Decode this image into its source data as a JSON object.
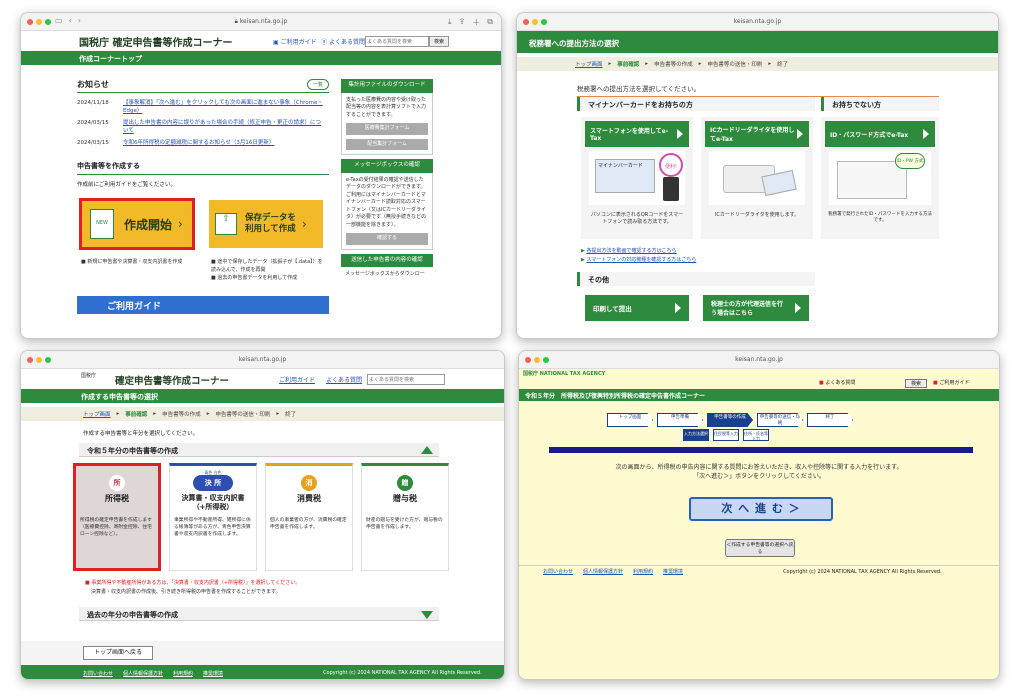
{
  "w1": {
    "url": "keisan.nta.go.jp",
    "logo": "国税庁 確定申告書等作成コーナー",
    "guide": "ご利用ガイド",
    "faq": "よくある質問",
    "search_placeholder": "よくある質問を検索",
    "search_btn": "検索",
    "bar": "作成コーナートップ",
    "notice_title": "お知らせ",
    "notice_btn": "一覧",
    "notices": [
      {
        "date": "2024/11/18",
        "text": "【事象解消】「次へ進む」をクリックしても次の画面に進まない事象（Chrome・Edge）"
      },
      {
        "date": "2024/03/15",
        "text": "提出した申告書の内容に誤りがあった場合の手続（修正申告・更正の請求）について"
      },
      {
        "date": "2024/03/15",
        "text": "令和6年所得税の定額減税に関するお知らせ（3月16日更新）"
      }
    ],
    "create_title": "申告書等を作成する",
    "create_sub": "作成前にご利用ガイドをご覧ください。",
    "start_new": "NEW",
    "start_label": "作成開始",
    "resume_label_1": "保存データを",
    "resume_label_2": "利用して作成",
    "start_note": "新規に申告書や決算書・収支内訳書を作成",
    "resume_notes": [
      "途中で保存したデータ（拡張子が【.data】）を読み込んで、作成を再開",
      "過去の申告書データを利用して作成"
    ],
    "banner": "ご利用ガイド",
    "side_dl_head": "集計用ファイルのダウンロード",
    "side_dl_text": "支払った医療費の内容や受け取った配当等の内容を表計算ソフトで入力することができます。",
    "side_dl_btn1": "医療費集計フォーム",
    "side_dl_btn2": "配当集計フォーム",
    "side_msg_head": "メッセージボックスの確認",
    "side_msg_text": "e-Taxの受付結果の確認や送信したデータのダウンロードができます。ご利用にはマイナンバーカードとマイナンバーカード読取対応のスマートフォン（又はICカードリーダライタ）が必要です（無授手続きなどの一部機能を除きます）。",
    "side_msg_btn": "確認する",
    "side_send_head": "送信した申告書の内容の確認",
    "side_send_text": "メッセージボックスからダウンロー"
  },
  "w2": {
    "url": "keisan.nta.go.jp",
    "bar": "税務署への提出方法の選択",
    "crumbs": [
      "トップ画面",
      "事前確認",
      "申告書等の作成",
      "申告書等の送信・印刷",
      "終了"
    ],
    "lead": "税務署への提出方法を選択してください。",
    "myna_head": "マイナンバーカードをお持ちの方",
    "nomyna_head": "お持ちでない方",
    "opt1": "スマートフォンを使用してe-Tax",
    "opt2": "ICカードリーダライタを使用してe-Tax",
    "opt3": "ID・パスワード方式でe-Tax",
    "card_label": "マイナンバーカード",
    "cap1": "パソコンに表示されるQRコードをスマートフォンで読み取る方法です。",
    "cap2": "ICカードリーダライタを使用します。",
    "cap3": "税務署で発行されたID・パスワードを入力する方法です。",
    "idpw_badge": "ID・PW 方式",
    "link1": "各提出方法を動画で確認する方はこちら",
    "link2": "スマートフォンの対応機種を確認する方はこちら",
    "other_head": "その他",
    "other1": "印刷して提出",
    "other2": "税理士の方が代理送信を行う場合はこちら"
  },
  "w3": {
    "url": "keisan.nta.go.jp",
    "agency": "国税庁",
    "logo": "確定申告書等作成コーナー",
    "guide": "ご利用ガイド",
    "faq": "よくある質問",
    "search_placeholder": "よくある質問を検索",
    "bar": "作成する申告書等の選択",
    "crumbs": [
      "トップ画面",
      "事前確認",
      "申告書等の作成",
      "申告書等の送信・印刷",
      "終了"
    ],
    "lead": "作成する申告書等と年分を選択してください。",
    "section1": "令和５年分の申告書等の作成",
    "cards": [
      {
        "badge": "所",
        "title": "所得税",
        "desc": "所得税の確定申告書を作成します（医療費控除、寄附金控除、住宅ローン控除など）。",
        "color": "#c03a3a"
      },
      {
        "badge": "決 所",
        "title": "決算書・収支内訳書\n（+所得税）",
        "desc": "事業所得や不動産所得、雑所得に係る帳簿等がある方が、青色申告決算書や収支内訳書を作成します。",
        "color": "#2f4fb0"
      },
      {
        "badge": "消",
        "title": "消費税",
        "desc": "個人の事業者の方が、消費税の確定申告書を作成します。",
        "color": "#e8a021"
      },
      {
        "badge": "贈",
        "title": "贈与税",
        "desc": "財産の贈与を受けた方が、贈与税の申告書を作成します。",
        "color": "#2e8b3e"
      }
    ],
    "badge_small": "青色  白色",
    "warn": "事業所得や不動産所得がある方は、「決算書・収支内訳書（+所得税）」を選択してください。",
    "warn2": "決算書・収支内訳書の作成後、引き続き所得税の申告書を作成することができます。",
    "section2": "過去の年分の申告書等の作成",
    "back": "トップ画面へ戻る",
    "footer_links": [
      "お問い合わせ",
      "個人情報保護方針",
      "利用規約",
      "推奨環境"
    ],
    "copyright": "Copyright (c) 2024 NATIONAL TAX AGENCY All Rights Reserved."
  },
  "w4": {
    "url": "keisan.nta.go.jp",
    "agency": "国税庁  NATIONAL TAX AGENCY",
    "faq": "よくある質問",
    "search_btn": "検索",
    "guide": "ご利用ガイド",
    "bar": "令和５年分　所得税及び復興特別所得税の確定申告書作成コーナー",
    "steps": [
      "トップ画面",
      "申告準備",
      "申告書等の作成",
      "申告書等の送信・印刷",
      "終了"
    ],
    "substeps": [
      "入力方法選択",
      "住民税等入力",
      "住所・氏名等入力"
    ],
    "msg1": "次の画面から、所得税の申告内容に関する質問にお答えいただき、収入や控除等に関する入力を行います。",
    "msg2": "「次へ進む＞」ボタンをクリックしてください。",
    "next_btn": "次 へ 進 む ＞",
    "back_btn": "＜作成する申告書等の選択へ戻る",
    "footer_links": [
      "お問い合わせ",
      "個人情報保護方針",
      "利用規約",
      "推奨環境"
    ],
    "copyright": "Copyright (c) 2024 NATIONAL TAX AGENCY All Rights Reserved."
  },
  "colors": {
    "nta_green": "#2e8b3e",
    "highlight": "#e02020",
    "link": "#1f55b8",
    "yellow_btn": "#f2b928",
    "legacy_bg": "#fffbd0"
  }
}
